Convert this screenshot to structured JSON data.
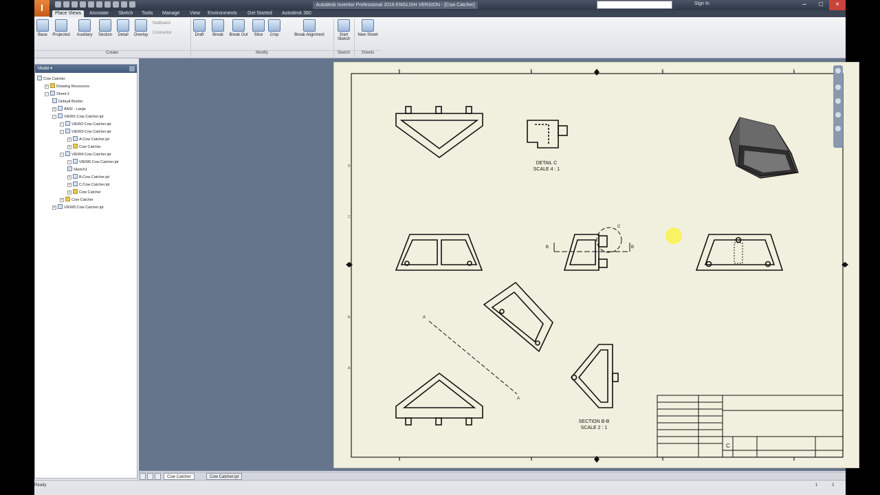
{
  "app": {
    "title": "Autodesk Inventor Professional 2016  ENGLISH  VERSION - [Cow Catcher]",
    "logo_letter": "I",
    "search_placeholder": "",
    "sign_in": "Sign In"
  },
  "tabs": [
    "Place Views",
    "Annotate",
    "Sketch",
    "Tools",
    "Manage",
    "View",
    "Environments",
    "Get Started",
    "Autodesk 360"
  ],
  "ribbon": {
    "create": {
      "label": "Create",
      "buttons": [
        "Base",
        "Projected",
        "Auxiliary",
        "Section",
        "Detail",
        "Overlay"
      ],
      "small": [
        "Nailboard",
        "Connector"
      ]
    },
    "modify": {
      "label": "Modify",
      "buttons": [
        "Draft",
        "Break",
        "Break Out",
        "Slice",
        "Crop",
        "Break Alignment"
      ]
    },
    "sketch": {
      "label": "Sketch",
      "buttons": [
        "Start Sketch"
      ]
    },
    "sheets": {
      "label": "Sheets",
      "buttons": [
        "New Sheet"
      ]
    }
  },
  "browser": {
    "header": "Model ▾",
    "nodes": [
      {
        "label": "Cow Catcher",
        "level": 0,
        "icon": "drawing"
      },
      {
        "label": "Drawing Resources",
        "level": 1,
        "icon": "folder",
        "twist": "+"
      },
      {
        "label": "Sheet:1",
        "level": 1,
        "icon": "sheet",
        "twist": "−"
      },
      {
        "label": "Default Border",
        "level": 2,
        "icon": "border"
      },
      {
        "label": "ANSI - Large",
        "level": 2,
        "icon": "titleblock",
        "twist": "+"
      },
      {
        "label": "VIEW1:Cow Catcher.ipt",
        "level": 2,
        "icon": "view",
        "twist": "−"
      },
      {
        "label": "VIEW2:Cow Catcher.ipt",
        "level": 3,
        "icon": "view",
        "twist": "−"
      },
      {
        "label": "VIEW3:Cow Catcher.ipt",
        "level": 3,
        "icon": "view",
        "twist": "−"
      },
      {
        "label": "A:Cow Catcher.ipt",
        "level": 4,
        "icon": "view",
        "twist": "+"
      },
      {
        "label": "Cow Catcher",
        "level": 4,
        "icon": "part",
        "twist": "+"
      },
      {
        "label": "VIEW4:Cow Catcher.ipt",
        "level": 3,
        "icon": "view",
        "twist": "−"
      },
      {
        "label": "VIEW6:Cow Catcher.ipt",
        "level": 4,
        "icon": "view",
        "twist": "−"
      },
      {
        "label": "Sketch1",
        "level": 4,
        "icon": "sketch"
      },
      {
        "label": "B:Cow Catcher.ipt",
        "level": 4,
        "icon": "view",
        "twist": "+"
      },
      {
        "label": "C:Cow Catcher.ipt",
        "level": 4,
        "icon": "view",
        "twist": "+"
      },
      {
        "label": "Cow Catcher",
        "level": 4,
        "icon": "part",
        "twist": "+"
      },
      {
        "label": "Cow Catcher",
        "level": 3,
        "icon": "part",
        "twist": "+"
      },
      {
        "label": "VIEW5:Cow Catcher.ipt",
        "level": 2,
        "icon": "view",
        "twist": "+"
      }
    ]
  },
  "drawing": {
    "detail_label": "DETAIL  C",
    "detail_scale": "SCALE 4 : 1",
    "section_label": "SECTION  B-B",
    "section_scale": "SCALE 2 : 1",
    "section_line": {
      "a": "A",
      "b": "B",
      "c": "C"
    },
    "border_numbers_top": [
      "4",
      "3",
      "2",
      "1"
    ],
    "border_letters_side": [
      "D",
      "C",
      "B",
      "A"
    ],
    "titleblock": {
      "size": "C"
    }
  },
  "doc_tabs": [
    "Cow Catcher",
    "Cow Catcher.ipt"
  ],
  "status": {
    "left": "Ready",
    "right1": "1",
    "right2": "2"
  },
  "colors": {
    "canvas": "#65758c",
    "sheet": "#f1f0de",
    "accent": "#e9843c"
  }
}
